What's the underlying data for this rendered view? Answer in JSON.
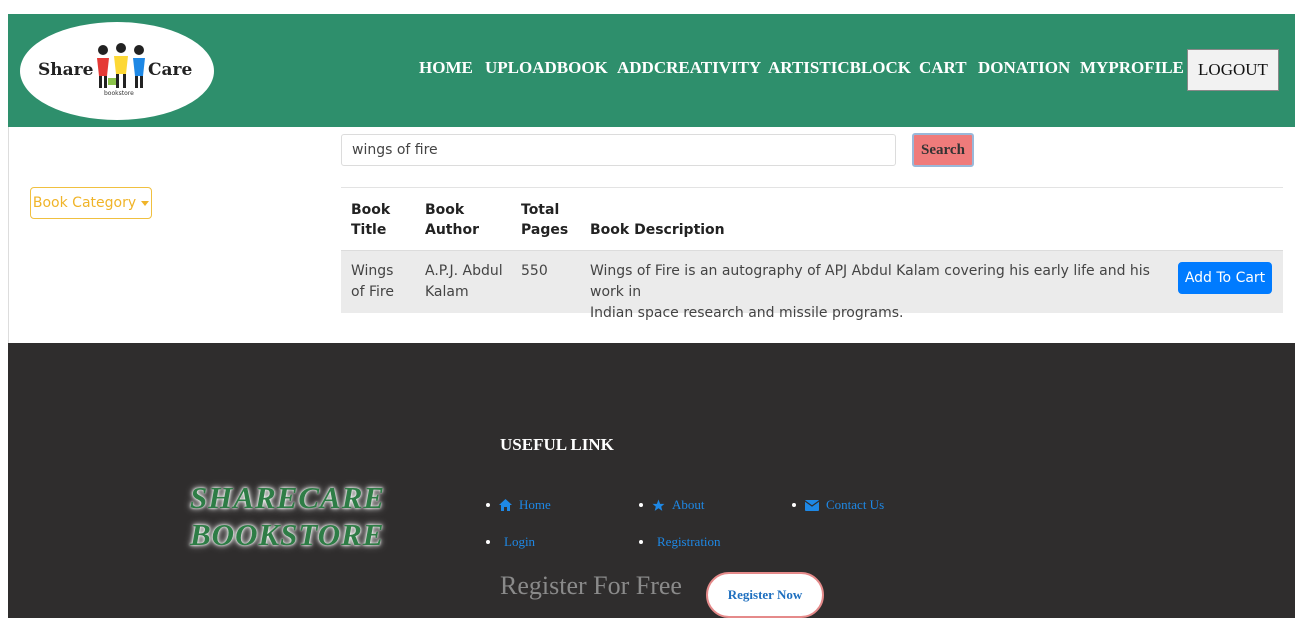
{
  "logo": {
    "word_left": "Share",
    "word_right": "Care",
    "sub": "bookstore"
  },
  "nav": {
    "items": [
      "HOME",
      "UPLOADBOOK",
      "ADDCREATIVITY",
      "ARTISTICBLOCK",
      "CART",
      "DONATION",
      "MYPROFILE"
    ],
    "logout": "LOGOUT"
  },
  "sidebar": {
    "category_label": "Book Category"
  },
  "search": {
    "value": "wings of fire",
    "button": "Search"
  },
  "table": {
    "headers": {
      "title": [
        "Book",
        "Title"
      ],
      "author": [
        "Book",
        "Author"
      ],
      "pages": [
        "Total",
        "Pages"
      ],
      "description": "Book Description"
    },
    "rows": [
      {
        "title": [
          "Wings",
          "of Fire"
        ],
        "author": [
          "A.P.J. Abdul",
          "Kalam"
        ],
        "pages": "550",
        "description": [
          "Wings of Fire is an autography of APJ Abdul Kalam covering his early life and his work in",
          "Indian space research and missile programs."
        ],
        "action": "Add To Cart"
      }
    ]
  },
  "footer": {
    "brand": [
      "SHARECARE",
      "BOOKSTORE"
    ],
    "useful_title": "USEFUL LINK",
    "links": {
      "home": "Home",
      "about": "About",
      "contact": "Contact Us",
      "login": "Login",
      "registration": "Registration"
    },
    "register_text": "Register For Free",
    "register_button": "Register Now"
  },
  "colors": {
    "header": "#2e8f6c",
    "footer": "#2f2d2d",
    "search_button": "#ef7b7b",
    "primary": "#007bff",
    "link": "#1e88e5"
  }
}
